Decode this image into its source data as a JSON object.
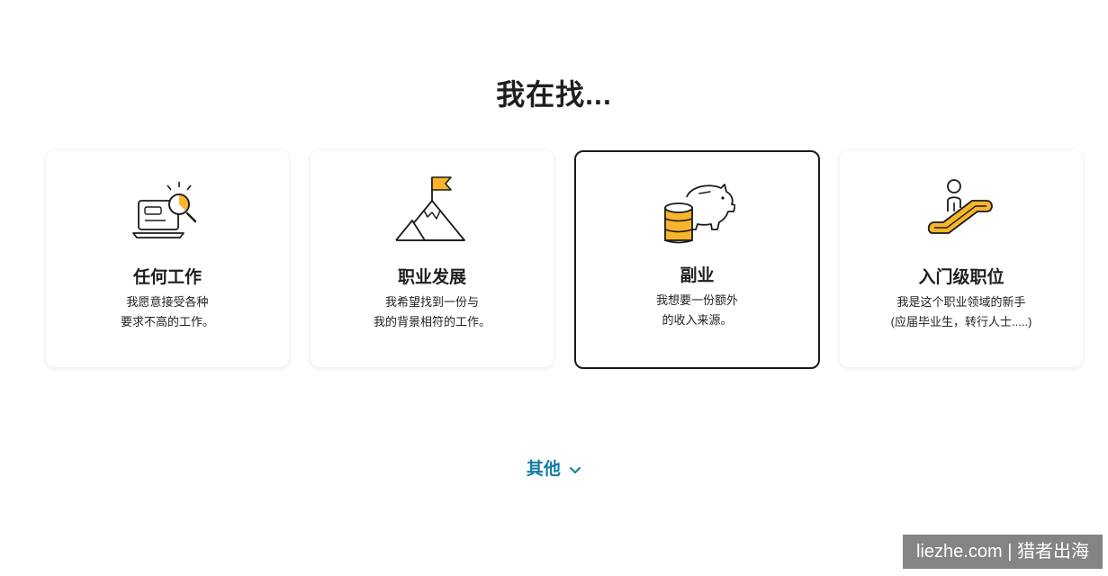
{
  "heading": "我在找...",
  "colors": {
    "accent_yellow": "#f7b52c",
    "link_blue": "#137ba3",
    "selected_border": "#1a1a1a"
  },
  "cards": [
    {
      "icon": "laptop-magnifier-icon",
      "title": "任何工作",
      "desc_line1": "我愿意接受各种",
      "desc_line2": "要求不高的工作。",
      "selected": false
    },
    {
      "icon": "mountain-flag-icon",
      "title": "职业发展",
      "desc_line1": "我希望找到一份与",
      "desc_line2": "我的背景相符的工作。",
      "selected": false
    },
    {
      "icon": "piggy-bank-coins-icon",
      "title": "副业",
      "desc_line1": "我想要一份额外",
      "desc_line2": "的收入来源。",
      "selected": true
    },
    {
      "icon": "escalator-person-icon",
      "title": "入门级职位",
      "desc_line1": "我是这个职业领域的新手",
      "desc_line2": "(应届毕业生，转行人士.....)",
      "selected": false
    }
  ],
  "other_label": "其他",
  "watermark": "liezhe.com | 猎者出海"
}
